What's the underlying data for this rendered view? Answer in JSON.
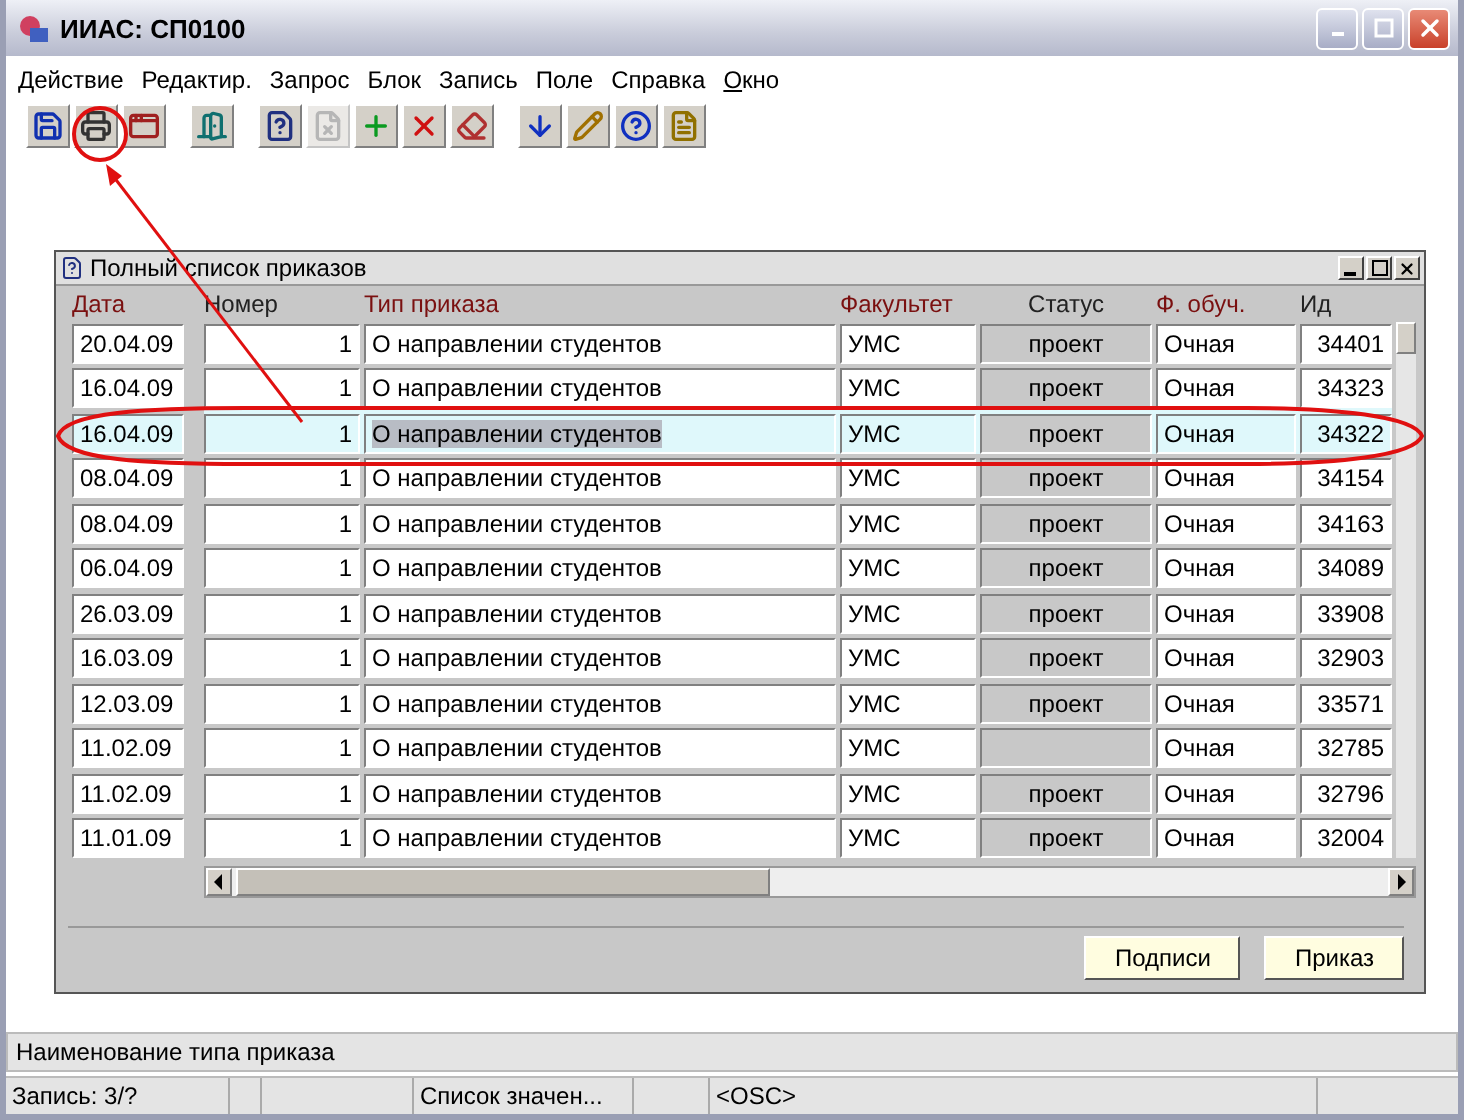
{
  "window": {
    "title": "ИИАС: СП0100"
  },
  "menu": [
    {
      "label": "Действие",
      "mnemonic": false
    },
    {
      "label": "Редактир.",
      "mnemonic": false
    },
    {
      "label": "Запрос",
      "mnemonic": false
    },
    {
      "label": "Блок",
      "mnemonic": false
    },
    {
      "label": "Запись",
      "mnemonic": false
    },
    {
      "label": "Поле",
      "mnemonic": false
    },
    {
      "label": "Справка",
      "mnemonic": false
    },
    {
      "label": "Окно",
      "mnemonic": true
    }
  ],
  "toolbar": [
    [
      {
        "kind": "save",
        "disabled": false
      },
      {
        "kind": "print",
        "disabled": false
      },
      {
        "kind": "window",
        "disabled": false
      }
    ],
    [
      {
        "kind": "exit",
        "disabled": false
      }
    ],
    [
      {
        "kind": "query",
        "disabled": false
      },
      {
        "kind": "cancel-query",
        "disabled": true
      },
      {
        "kind": "insert",
        "disabled": false
      },
      {
        "kind": "delete",
        "disabled": false
      },
      {
        "kind": "clear",
        "disabled": false
      }
    ],
    [
      {
        "kind": "down",
        "disabled": false
      },
      {
        "kind": "edit",
        "disabled": false
      },
      {
        "kind": "help",
        "disabled": false
      },
      {
        "kind": "notes",
        "disabled": false
      }
    ]
  ],
  "form": {
    "title": "Полный список приказов",
    "date_column": {
      "label": "Дата",
      "required": true
    },
    "columns": [
      {
        "label": "Номер",
        "required": false
      },
      {
        "label": "Тип приказа",
        "required": true
      },
      {
        "label": "Факультет",
        "required": true
      },
      {
        "label": "Статус",
        "required": false
      },
      {
        "label": "Ф. обуч.",
        "required": true
      },
      {
        "label": "Ид",
        "required": false
      }
    ],
    "rows": [
      {
        "date": "20.04.09",
        "number": "1",
        "type": "О направлении студентов",
        "faculty": "УМС",
        "status": "проект",
        "study_form": "Очная",
        "id": "34401",
        "selected": false
      },
      {
        "date": "16.04.09",
        "number": "1",
        "type": "О направлении студентов",
        "faculty": "УМС",
        "status": "проект",
        "study_form": "Очная",
        "id": "34323",
        "selected": false
      },
      {
        "date": "16.04.09",
        "number": "1",
        "type": "О направлении студентов",
        "faculty": "УМС",
        "status": "проект",
        "study_form": "Очная",
        "id": "34322",
        "selected": true
      },
      {
        "date": "08.04.09",
        "number": "1",
        "type": "О направлении студентов",
        "faculty": "УМС",
        "status": "проект",
        "study_form": "Очная",
        "id": "34154",
        "selected": false
      },
      {
        "date": "08.04.09",
        "number": "1",
        "type": "О направлении студентов",
        "faculty": "УМС",
        "status": "проект",
        "study_form": "Очная",
        "id": "34163",
        "selected": false
      },
      {
        "date": "06.04.09",
        "number": "1",
        "type": "О направлении студентов",
        "faculty": "УМС",
        "status": "проект",
        "study_form": "Очная",
        "id": "34089",
        "selected": false
      },
      {
        "date": "26.03.09",
        "number": "1",
        "type": "О направлении студентов",
        "faculty": "УМС",
        "status": "проект",
        "study_form": "Очная",
        "id": "33908",
        "selected": false
      },
      {
        "date": "16.03.09",
        "number": "1",
        "type": "О направлении студентов",
        "faculty": "УМС",
        "status": "проект",
        "study_form": "Очная",
        "id": "32903",
        "selected": false
      },
      {
        "date": "12.03.09",
        "number": "1",
        "type": "О направлении студентов",
        "faculty": "УМС",
        "status": "проект",
        "study_form": "Очная",
        "id": "33571",
        "selected": false
      },
      {
        "date": "11.02.09",
        "number": "1",
        "type": "О направлении студентов",
        "faculty": "УМС",
        "study_form": "Очная",
        "id": "32785",
        "selected": false
      },
      {
        "date": "11.02.09",
        "number": "1",
        "type": "О направлении студентов",
        "faculty": "УМС",
        "status": "проект",
        "study_form": "Очная",
        "id": "32796",
        "selected": false
      },
      {
        "date": "11.01.09",
        "number": "1",
        "type": "О направлении студентов",
        "faculty": "УМС",
        "status": "проект",
        "study_form": "Очная",
        "id": "32004",
        "selected": false
      }
    ],
    "buttons": [
      "Подписи",
      "Приказ"
    ]
  },
  "hint": "Наименование типа приказа",
  "status_bar": {
    "record": "Запись: 3/?",
    "list": "Список значен...",
    "mode": "<OSC>"
  }
}
